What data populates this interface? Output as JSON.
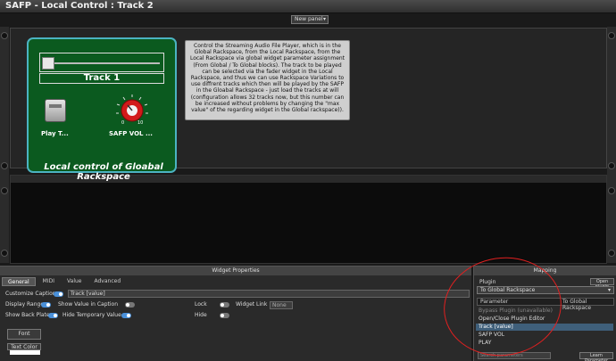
{
  "window": {
    "title": "SAFP - Local Control : Track 2"
  },
  "panel_selector": {
    "value": "New panel",
    "arrow": "▾"
  },
  "widgets": {
    "track_label": "Track 1",
    "play_label": "Play T...",
    "knob_label": "SAFP VOL ...",
    "knob_scale": [
      "0",
      "10"
    ],
    "panel_caption": "Local control of Gloabal Rackspace"
  },
  "info_text": "Control the Streaming Audio File Player, which is in the Global Rackspace, from the Local Rackspace, from the Local Rackspace via global widget parameter assignment (From Global / To Global blocks). The track to be played can be selected via the fader widget in the Local Rackspace, and thus we can use Rackspace Variations to use diffrent tracks which then will be played by the SAFP in the Gloabal Rackspace - just load the tracks at will (configuration allows 32 tracks now, but this number can be increased without problems by changing the \"max value\" of the regarding widget in the Global rackspace)).",
  "properties": {
    "header": "Widget Properties",
    "tabs": [
      "General",
      "MIDI",
      "Value",
      "Advanced"
    ],
    "customize_caption": "Customize Caption",
    "caption_value": "Track [value]",
    "display_range": "Display Range",
    "show_value_in_caption": "Show Value in Caption",
    "lock": "Lock",
    "widget_link": "Widget Link",
    "widget_link_value": "None",
    "show_back_plate": "Show Back Plate",
    "hide_temporary_value": "Hide Temporary Value",
    "hide": "Hide",
    "font_button": "Font",
    "text_color_button": "Text Color"
  },
  "mapping": {
    "header": "Mapping",
    "plugin_label": "Plugin",
    "open_plugin_button": "Open plugin",
    "plugin_value": "To Global Rackspace",
    "parameter_label": "Parameter",
    "parameter_value": "To Global Rackspace",
    "items": [
      "Bypass Plugin (unavailable)",
      "Open/Close Plugin Editor",
      "Track [value]",
      "SAFP VOL",
      "PLAY"
    ],
    "search_placeholder": "Search parameters",
    "learn_button": "Learn Parameter"
  },
  "colors": {
    "panel_green": "#0b5a1f",
    "panel_border": "#4bb3c2",
    "annotation_red": "#e02020",
    "toggle_blue": "#4a90d9"
  }
}
